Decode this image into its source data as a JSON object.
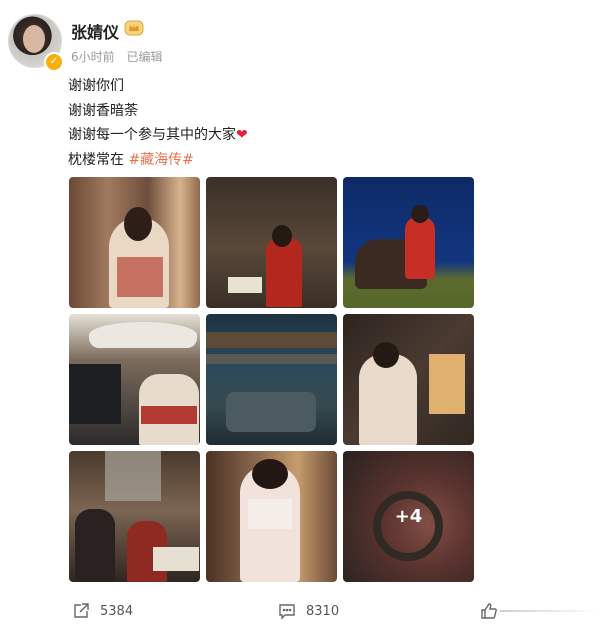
{
  "user": {
    "name": "张婧仪",
    "time": "6小时前",
    "edited": "已编辑"
  },
  "post": {
    "lines": [
      "谢谢你们",
      "谢谢香暗荼",
      "谢谢每一个参与其中的大家"
    ],
    "heart": "❤",
    "last_prefix": "枕楼常在",
    "hashtag": "#藏海传#"
  },
  "photos": {
    "more_label": "+4"
  },
  "footer": {
    "share_count": "5384",
    "comment_count": "8310"
  },
  "colors": {
    "hashtag": "#eb7350",
    "heart": "#e0243b",
    "verified": "#f5b10a"
  }
}
